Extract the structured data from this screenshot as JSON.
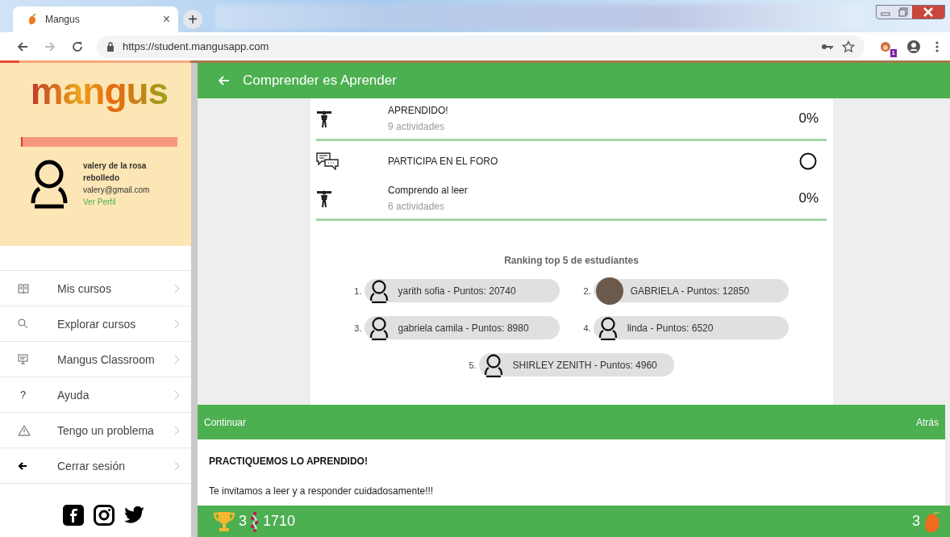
{
  "browser": {
    "tab": {
      "title": "Mangus",
      "close": "×"
    },
    "new_tab": "+",
    "url": "https://student.mangusapp.com",
    "extension_badge": "1"
  },
  "sidebar": {
    "logo": "mangus",
    "progress": {
      "level": 0.01
    },
    "user": {
      "name": "valery de la rosa rebolledo",
      "email": "valery@gmail.com",
      "link": "Ver Perfil"
    },
    "items": [
      {
        "kind": "book",
        "label": "Mis cursos"
      },
      {
        "kind": "search",
        "label": "Explorar cursos"
      },
      {
        "kind": "classroom",
        "label": "Mangus Classroom"
      },
      {
        "kind": "help",
        "glyph": "?",
        "label": "Ayuda"
      },
      {
        "kind": "warning",
        "label": "Tengo un problema"
      },
      {
        "kind": "logout",
        "label": "Cerrar sesión"
      }
    ]
  },
  "header": {
    "title": "Comprender es Aprender"
  },
  "activities": [
    {
      "kind": "exercise",
      "title": "APRENDIDO!",
      "subtitle": "9 actividades",
      "status": "0%",
      "divider": true
    },
    {
      "kind": "forum",
      "title": "PARTICIPA EN EL FORO",
      "divider": false
    },
    {
      "kind": "exercise",
      "title": "Comprendo al leer",
      "subtitle": "6 actividades",
      "status": "0%",
      "divider": true
    }
  ],
  "ranking": {
    "title": "Ranking top 5 de estudiantes",
    "students": [
      {
        "rank": "1.",
        "label": "yarith sofia - Puntos: 20740",
        "photo": false
      },
      {
        "rank": "2.",
        "label": "GABRIELA - Puntos: 12850",
        "photo": true
      },
      {
        "rank": "3.",
        "label": "gabriela camila - Puntos: 8980",
        "photo": false
      },
      {
        "rank": "4.",
        "label": "linda - Puntos: 6520",
        "photo": false
      },
      {
        "rank": "5.",
        "label": "SHIRLEY ZENITH - Puntos: 4960",
        "photo": false
      }
    ]
  },
  "action_bar": {
    "continue": "Continuar",
    "back": "Atrás"
  },
  "practice": {
    "title": "PRACTIQUEMOS LO APRENDIDO!",
    "text": "Te invitamos a leer y a responder cuidadosamente!!!"
  },
  "footer": {
    "trophies": "3",
    "points": "1710",
    "mangos": "3"
  }
}
